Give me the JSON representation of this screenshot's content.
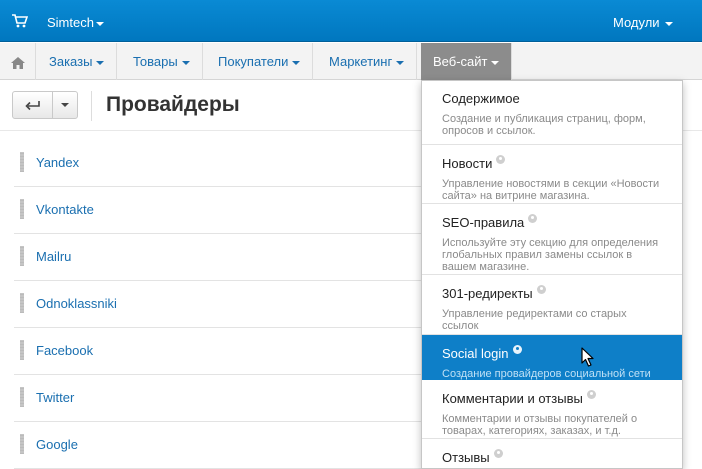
{
  "topbar": {
    "store_name": "Simtech",
    "modules_label": "Модули"
  },
  "nav": {
    "items": [
      {
        "label": "Заказы"
      },
      {
        "label": "Товары"
      },
      {
        "label": "Покупатели"
      },
      {
        "label": "Маркетинг"
      },
      {
        "label": "Веб-сайт"
      }
    ]
  },
  "page": {
    "title": "Провайдеры"
  },
  "providers": [
    {
      "name": "Yandex"
    },
    {
      "name": "Vkontakte"
    },
    {
      "name": "Mailru"
    },
    {
      "name": "Odnoklassniki"
    },
    {
      "name": "Facebook"
    },
    {
      "name": "Twitter"
    },
    {
      "name": "Google"
    }
  ],
  "dropdown": {
    "items": [
      {
        "title": "Содержимое",
        "desc1": "Создание и публикация страниц, форм,",
        "desc2": "опросов и ссылок.",
        "desc3": ""
      },
      {
        "title": "Новости",
        "desc1": "Управление новостями в секции «Новости",
        "desc2": "сайта» на витрине магазина.",
        "desc3": ""
      },
      {
        "title": "SEO-правила",
        "desc1": "Используйте эту секцию для определения",
        "desc2": "глобальных правил замены ссылок в",
        "desc3": "вашем магазине."
      },
      {
        "title": "301-редиректы",
        "desc1": "Управление редиректами со старых",
        "desc2": "ссылок",
        "desc3": ""
      },
      {
        "title": "Social login",
        "desc1": "Создание провайдеров социальной сети",
        "desc2": "",
        "desc3": ""
      },
      {
        "title": "Комментарии и отзывы",
        "desc1": "Комментарии и отзывы покупателей о",
        "desc2": "товарах, категориях, заказах, и т.д.",
        "desc3": ""
      },
      {
        "title": "Отзывы",
        "desc1": "",
        "desc2": "",
        "desc3": ""
      }
    ]
  },
  "colors": {
    "topbar": "#0a8ad4",
    "link": "#1a6fb0",
    "active_menu": "#0e7fc8"
  }
}
